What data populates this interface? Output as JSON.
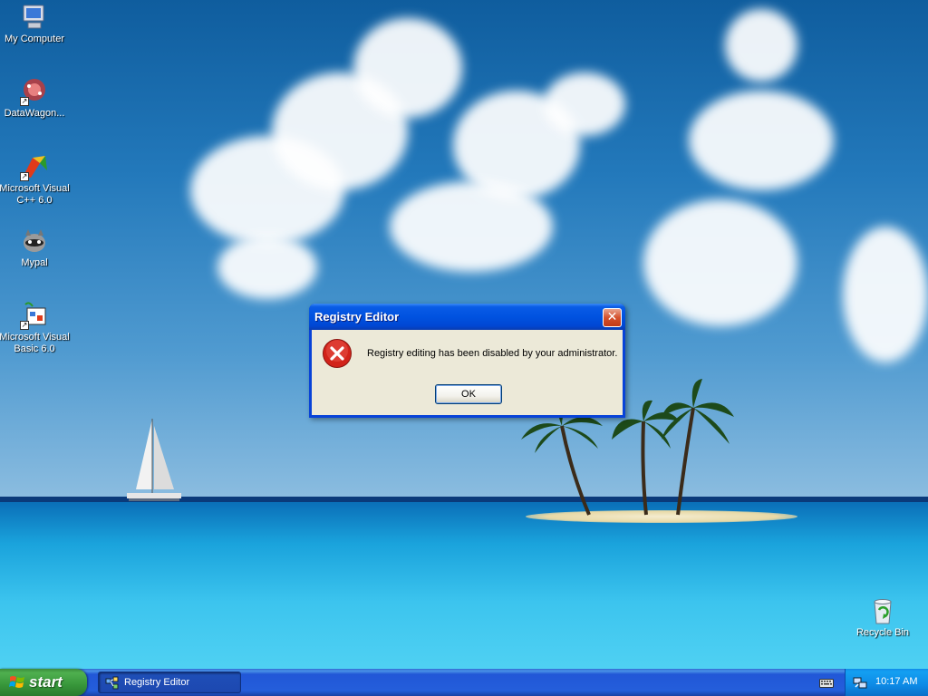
{
  "desktop": {
    "icons": [
      {
        "label": "My Computer",
        "icon": "my-computer-icon"
      },
      {
        "label": "DataWagon...",
        "icon": "datawagon-icon"
      },
      {
        "label": "Microsoft Visual C++ 6.0",
        "icon": "visual-cpp-icon"
      },
      {
        "label": "Mypal",
        "icon": "mypal-icon"
      },
      {
        "label": "Microsoft Visual Basic 6.0",
        "icon": "visual-basic-icon"
      },
      {
        "label": "Recycle Bin",
        "icon": "recycle-bin-icon"
      }
    ]
  },
  "dialog": {
    "title": "Registry Editor",
    "message": "Registry editing has been disabled by your administrator.",
    "ok_label": "OK",
    "close_glyph": "✕"
  },
  "taskbar": {
    "start_label": "start",
    "tasks": [
      {
        "label": "Registry Editor"
      }
    ],
    "clock": "10:17 AM"
  },
  "colors": {
    "title_bar": "#0052e0",
    "start_green": "#37963a",
    "taskbar_blue": "#245edb",
    "tray_blue": "#0d8ae6",
    "error_red": "#d2231a"
  }
}
